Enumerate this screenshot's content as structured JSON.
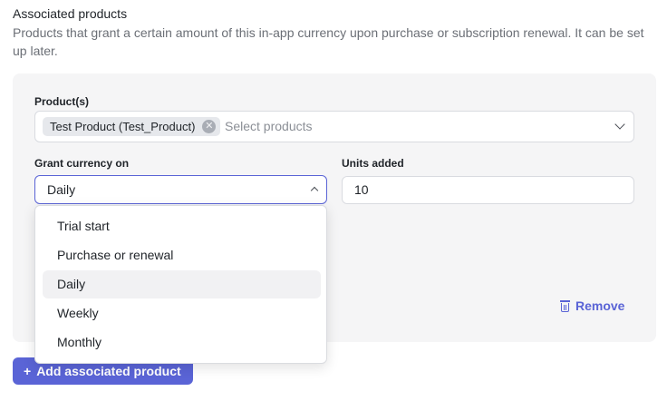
{
  "section": {
    "title": "Associated products",
    "description": "Products that grant a certain amount of this in-app currency upon purchase or subscription renewal. It can be set up later."
  },
  "products_field": {
    "label": "Product(s)",
    "chips": [
      "Test Product (Test_Product)"
    ],
    "chip_remove_icon": "close-circle-icon",
    "placeholder": "Select products"
  },
  "grant_field": {
    "label": "Grant currency on",
    "value": "Daily",
    "options": [
      "Trial start",
      "Purchase or renewal",
      "Daily",
      "Weekly",
      "Monthly"
    ],
    "selected_index": 2,
    "expanded": true
  },
  "units_field": {
    "label": "Units added",
    "value": "10"
  },
  "remove_button": {
    "label": "Remove",
    "icon": "trash-icon"
  },
  "add_button": {
    "label": "Add associated product",
    "icon": "plus-icon"
  },
  "colors": {
    "accent": "#5a64d6",
    "card_bg": "#f5f5f6",
    "selected_option_bg": "#f1f1f3"
  }
}
